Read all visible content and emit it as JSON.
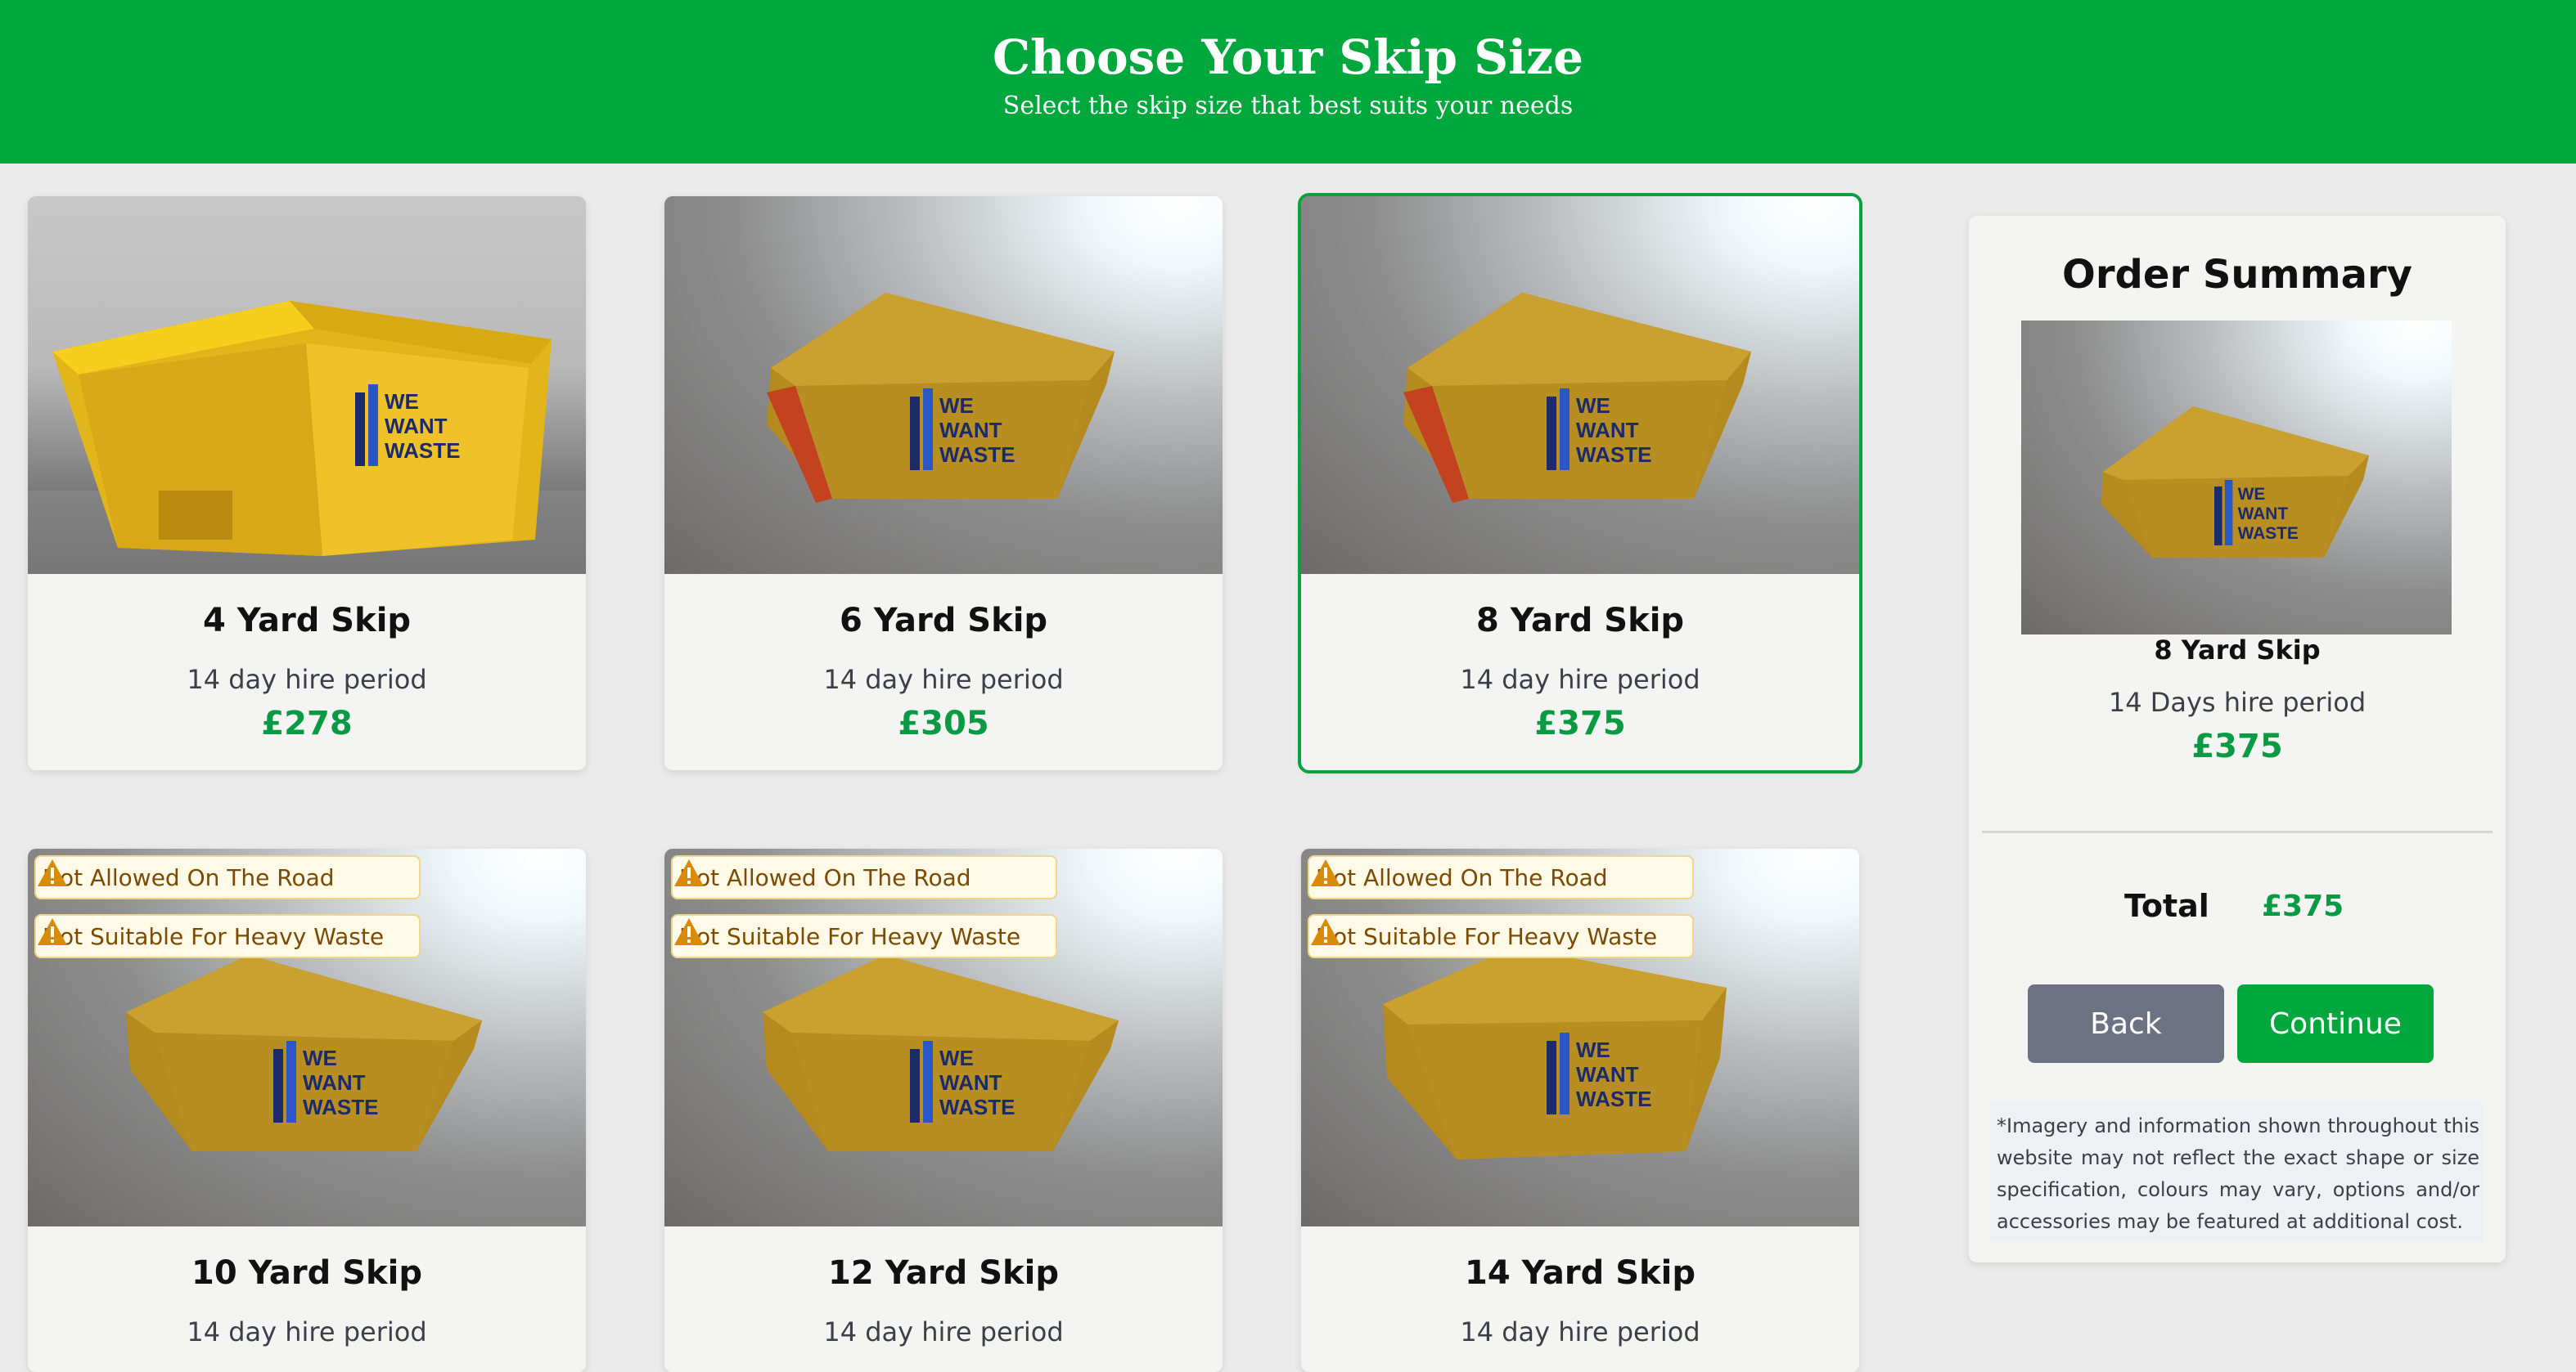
{
  "header": {
    "title": "Choose Your Skip Size",
    "subtitle": "Select the skip size that best suits your needs"
  },
  "theme": {
    "brand_green": "#00a73d",
    "price_green": "#0a9a44",
    "warning_text": "#7c4a00",
    "warning_bg": "#fff9e8",
    "back_button": "#6c7282"
  },
  "skips": [
    {
      "title": "4 Yard Skip",
      "period": "14 day hire period",
      "price": "£278",
      "selected": false,
      "warnings": []
    },
    {
      "title": "6 Yard Skip",
      "period": "14 day hire period",
      "price": "£305",
      "selected": false,
      "warnings": []
    },
    {
      "title": "8 Yard Skip",
      "period": "14 day hire period",
      "price": "£375",
      "selected": true,
      "warnings": []
    },
    {
      "title": "10 Yard Skip",
      "period": "14 day hire period",
      "price": "",
      "selected": false,
      "warnings": [
        "Not Allowed On The Road",
        "Not Suitable For Heavy Waste"
      ]
    },
    {
      "title": "12 Yard Skip",
      "period": "14 day hire period",
      "price": "",
      "selected": false,
      "warnings": [
        "Not Allowed On The Road",
        "Not Suitable For Heavy Waste"
      ]
    },
    {
      "title": "14 Yard Skip",
      "period": "14 day hire period",
      "price": "",
      "selected": false,
      "warnings": [
        "Not Allowed On The Road",
        "Not Suitable For Heavy Waste"
      ]
    }
  ],
  "skip_logo_text": [
    "WE",
    "WANT",
    "WASTE"
  ],
  "warning_icon": "warning-triangle-icon",
  "summary": {
    "title": "Order Summary",
    "skip_name": "8 Yard Skip",
    "period": "14 Days hire period",
    "price": "£375",
    "total_label": "Total",
    "total_value": "£375",
    "back_label": "Back",
    "continue_label": "Continue",
    "disclaimer": "*Imagery and information shown throughout this website may not reflect the exact shape or size specification, colours may vary, options and/or accessories may be featured at additional cost."
  }
}
